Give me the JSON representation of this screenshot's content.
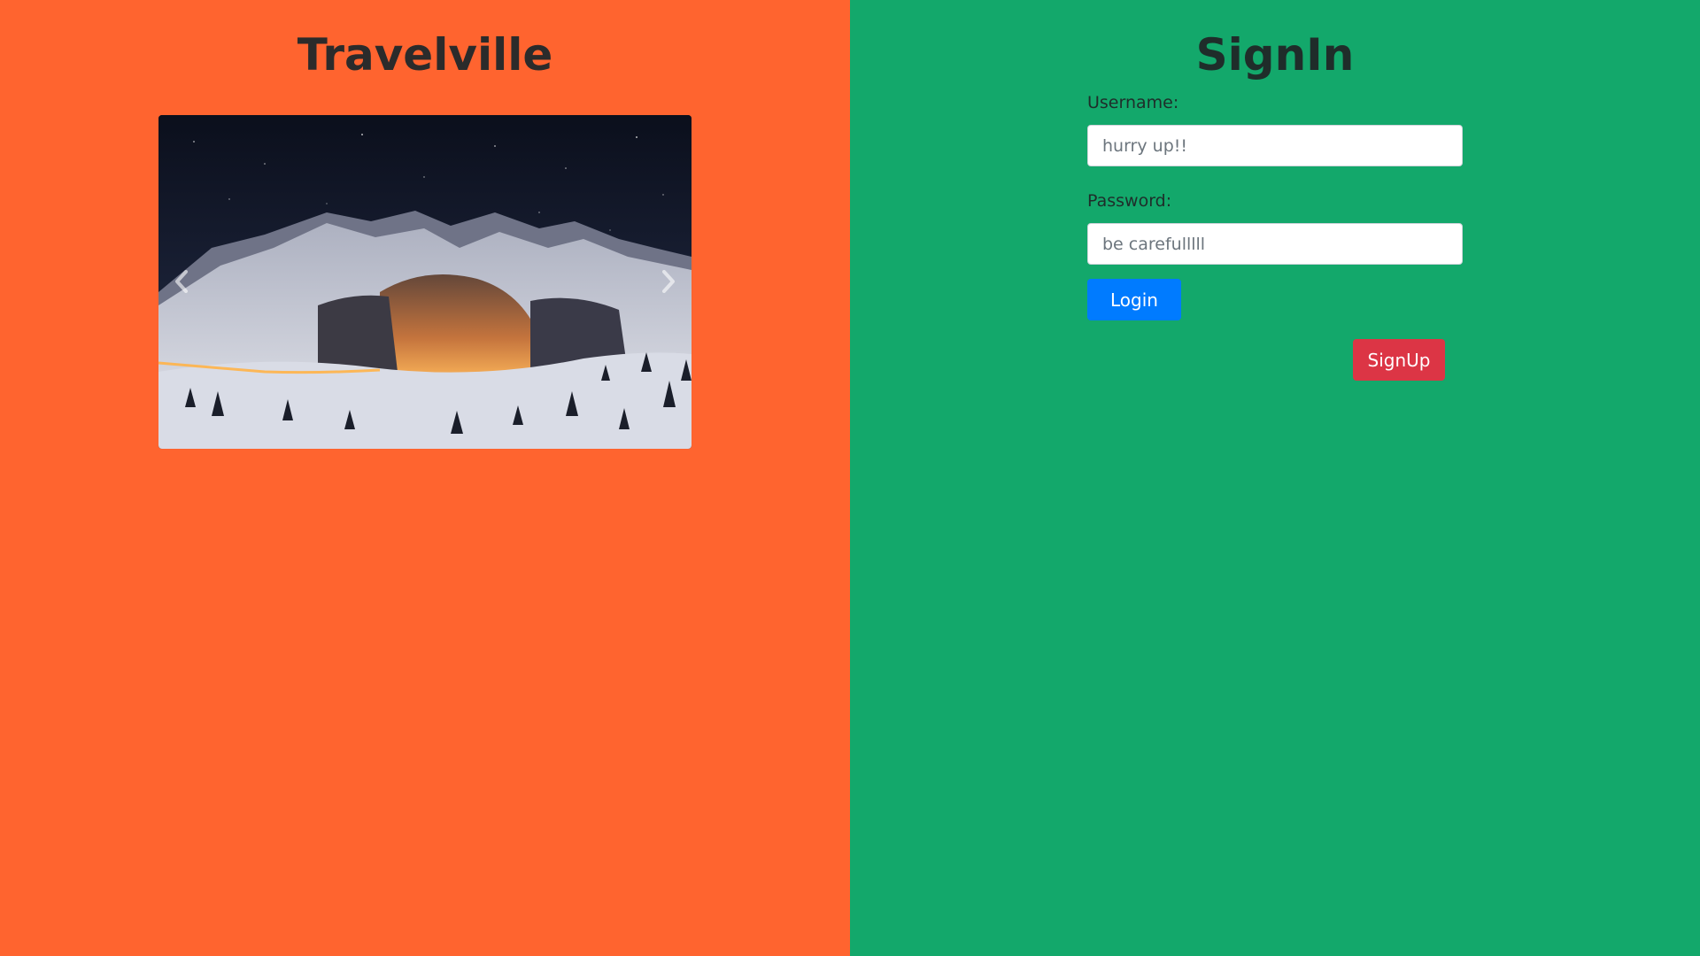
{
  "left": {
    "title": "Travelville",
    "carousel": {
      "prev_icon": "chevron-left-icon",
      "next_icon": "chevron-right-icon"
    },
    "background": "#FF642F"
  },
  "right": {
    "title": "SignIn",
    "background": "#13A86B",
    "form": {
      "username_label": "Username:",
      "username_placeholder": "hurry up!!",
      "password_label": "Password:",
      "password_placeholder": "be carefulllll"
    },
    "login_label": "Login",
    "signup_label": "SignUp"
  },
  "colors": {
    "login": "#007BFF",
    "signup": "#DC3545"
  }
}
